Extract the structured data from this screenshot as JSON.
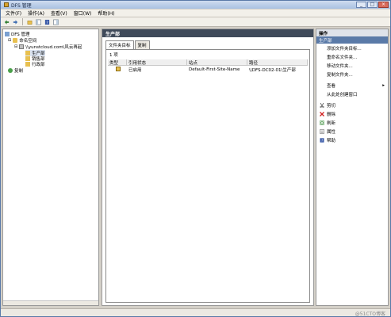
{
  "window": {
    "title": "DFS 管理"
  },
  "menu": {
    "items": [
      "文件(F)",
      "操作(A)",
      "查看(V)",
      "窗口(W)",
      "帮助(H)"
    ]
  },
  "tree": {
    "root": "DFS 管理",
    "namespace": "命名空间",
    "server": "\\\\yunstcloud.com\\风云再起",
    "folders": [
      "生产部",
      "销售部",
      "行政部"
    ],
    "replication": "复制"
  },
  "center": {
    "header": "生产部",
    "tabs": [
      "文件夹目标",
      "复制"
    ],
    "count": "1 项",
    "columns": [
      "类型",
      "引用状态",
      "站点",
      "路径"
    ],
    "rows": [
      {
        "type_icon": "folder-target-icon",
        "status": "已启用",
        "site": "Default-First-Site-Name",
        "path": "\\\\DFS-DC02-01\\生产部"
      }
    ]
  },
  "actions": {
    "title": "操作",
    "section": "生产部",
    "items": [
      {
        "label": "添加文件夹目标...",
        "icon": ""
      },
      {
        "label": "重命名文件夹...",
        "icon": ""
      },
      {
        "label": "移动文件夹...",
        "icon": ""
      },
      {
        "label": "复制文件夹...",
        "icon": ""
      },
      {
        "label": "查看",
        "icon": "",
        "submenu": true
      },
      {
        "label": "从此处创建窗口",
        "icon": ""
      },
      {
        "label": "剪切",
        "icon": "cut-icon"
      },
      {
        "label": "删除",
        "icon": "delete-icon"
      },
      {
        "label": "刷新",
        "icon": "refresh-icon"
      },
      {
        "label": "属性",
        "icon": "properties-icon"
      },
      {
        "label": "帮助",
        "icon": "help-icon"
      }
    ]
  },
  "watermark": "@51CTO博客"
}
